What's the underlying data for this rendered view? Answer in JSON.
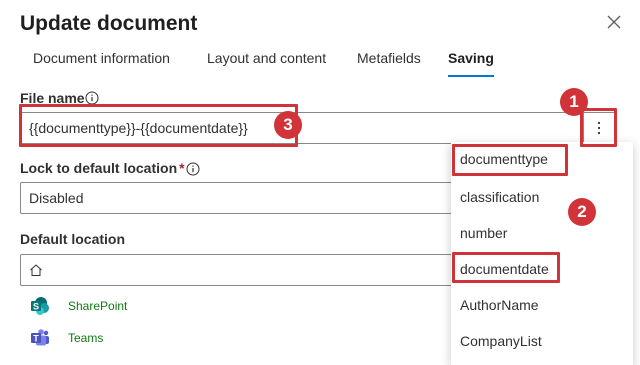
{
  "dialog": {
    "title": "Update document"
  },
  "tabs": [
    {
      "label": "Document information",
      "active": false
    },
    {
      "label": "Layout and content",
      "active": false
    },
    {
      "label": "Metafields",
      "active": false
    },
    {
      "label": "Saving",
      "active": true
    }
  ],
  "file_name": {
    "label": "File name",
    "value": "{{documenttype}}-{{documentdate}}"
  },
  "lock_location": {
    "label": "Lock to default location",
    "required_mark": "*",
    "value": "Disabled"
  },
  "default_location": {
    "label": "Default location",
    "items": [
      {
        "label": "SharePoint",
        "icon": "sharepoint-icon"
      },
      {
        "label": "Teams",
        "icon": "teams-icon"
      }
    ]
  },
  "metadata_menu": {
    "items": [
      "documenttype",
      "classification",
      "number",
      "documentdate",
      "AuthorName",
      "CompanyList"
    ]
  },
  "callouts": {
    "one": "1",
    "two": "2",
    "three": "3"
  },
  "colors": {
    "accent": "#0078d4",
    "callout": "#d13438",
    "link_green": "#107c10"
  }
}
